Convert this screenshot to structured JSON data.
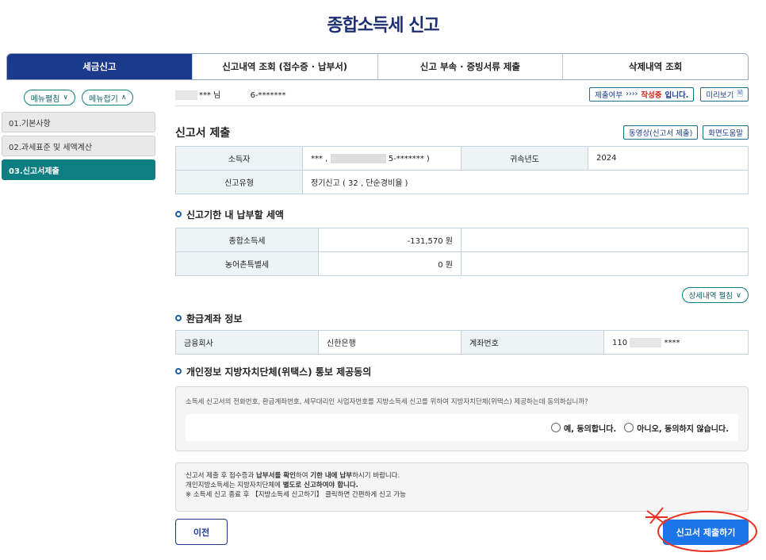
{
  "page": {
    "title": "종합소득세 신고"
  },
  "tabs": [
    "세금신고",
    "신고내역 조회 (접수증 · 납부서)",
    "신고 부속 · 증빙서류 제출",
    "삭제내역 조회"
  ],
  "leftnav": {
    "menu_edit": "메뉴펼침",
    "menu_fold": "메뉴접기",
    "items": [
      "01.기본사항",
      "02.과세표준 및 세액계산",
      "03.신고서제출"
    ]
  },
  "user": {
    "name_suffix": "*** 님",
    "id_suffix": "6-*******",
    "status_label": "제출여부",
    "status_arrow": "››››",
    "status_value": "작성중",
    "status_tail": "입니다.",
    "preview": "미리보기"
  },
  "filing": {
    "title": "신고서 제출",
    "video_btn": "동영상(신고서 제출)",
    "help_btn": "화면도움말",
    "rows": {
      "taxpayer_label": "소득자",
      "taxpayer_value_a": "*** ,",
      "taxpayer_value_b": "5-******* )",
      "year_label": "귀속년도",
      "year_value": "2024",
      "type_label": "신고유형",
      "type_value": "정기신고 ( 32 , 단순경비율 )"
    }
  },
  "tax_due": {
    "title": "신고기한 내 납부할 세액",
    "income_tax_label": "종합소득세",
    "income_tax_value": "-131,570 원",
    "rural_tax_label": "농어촌특별세",
    "rural_tax_value": "0 원",
    "detail_btn": "상세내역 펼침"
  },
  "refund": {
    "title": "환급계좌 정보",
    "bank_label": "금융회사",
    "bank_value": "신한은행",
    "account_label": "계좌번호",
    "account_prefix": "110",
    "account_suffix": "****"
  },
  "consent": {
    "title": "개인정보 지방자치단체(위택스) 통보 제공동의",
    "question": "소득세 신고서의 전화번호, 환급계좌번호, 세무대리인 사업자번호를 지방소득세 신고를 위하여 지방자치단체(위택스) 제공하는데 동의하십니까?",
    "yes": "예, 동의합니다.",
    "no": "아니오, 동의하지 않습니다."
  },
  "notice": {
    "line1_a": "신고서 제출 후 접수증과 ",
    "line1_b": "납부서를 확인",
    "line1_c": "하여 ",
    "line1_d": "기한 내에 납부",
    "line1_e": "하시기 바랍니다.",
    "line2_a": "개인지방소득세는 지방자치단체에 ",
    "line2_b": "별도로 신고하여야 합니다.",
    "line3": "※ 소득세 신고 종료 후 【지방소득세 신고하기】 클릭하면 간편하게 신고 가능"
  },
  "footer": {
    "prev": "이전",
    "submit": "신고서 제출하기"
  },
  "colors": {
    "primary": "#1b3a8c",
    "teal": "#0d7f83",
    "submit": "#1b74e8",
    "annotation": "#e8321f"
  }
}
